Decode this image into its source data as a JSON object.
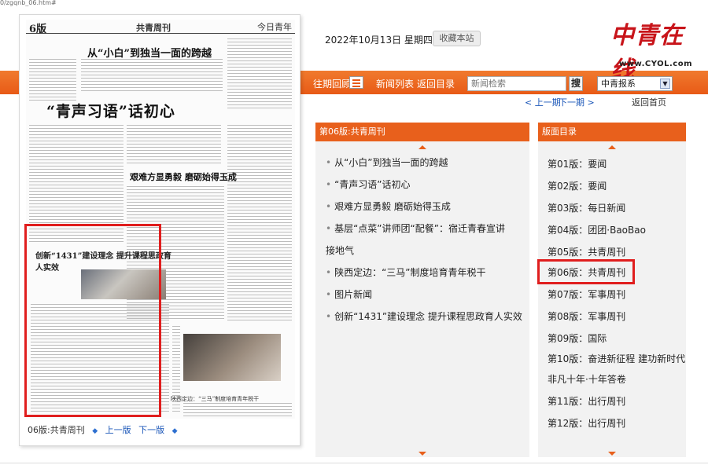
{
  "url_hint": "0/zgqnb_06.htm#",
  "header": {
    "date": "2022年10月13日 星期四",
    "bookmark": "收藏本站",
    "brand_cn": "中青在线",
    "brand_url": "www.CYOL.com"
  },
  "nav": {
    "past": "往期回顾",
    "list": "新闻列表",
    "back": "返回目录",
    "search_placeholder": "新闻检索",
    "search_btn": "搜",
    "select_value": "中青报系"
  },
  "pager": {
    "prev": "< 上一期",
    "next": "下一期 >",
    "home": "返回首页"
  },
  "newspaper": {
    "page_num": "6版",
    "title": "共青周刊",
    "logo": "今日青年",
    "hl1": "从“小白”到独当一面的跨越",
    "hl2": "“青声习语”话初心",
    "hl3": "艰难方显勇毅 磨砺始得玉成",
    "hl4": "创新“1431”建设理念 提升课程思政育人实效",
    "hl5": "陕西定边：“三马”制度培育青年税干"
  },
  "footer": {
    "label": "06版:共青周刊",
    "prev": "上一版",
    "next": "下一版"
  },
  "articles_panel": {
    "title": "第06版:共青周刊",
    "items": [
      "从“小白”到独当一面的跨越",
      "“青声习语”话初心",
      "艰难方显勇毅 磨砺始得玉成",
      "基层“点菜”讲师团“配餐”：宿迁青春宣讲",
      "接地气",
      "陕西定边：“三马”制度培育青年税干",
      "图片新闻",
      "创新“1431”建设理念 提升课程思政育人实效"
    ]
  },
  "editions_panel": {
    "title": "版面目录",
    "items": [
      "第01版：要闻",
      "第02版：要闻",
      "第03版：每日新闻",
      "第04版：团团·BaoBao",
      "第05版：共青周刊",
      "第06版：共青周刊",
      "第07版：军事周刊",
      "第08版：军事周刊",
      "第09版：国际",
      "第10版：奋进新征程 建功新时代",
      "非凡十年·十年答卷",
      "第11版：出行周刊",
      "第12版：出行周刊"
    ]
  },
  "colors": {
    "accent_orange": "#e8601c",
    "highlight_red": "#e01e1e",
    "link_blue": "#1a56b8"
  }
}
